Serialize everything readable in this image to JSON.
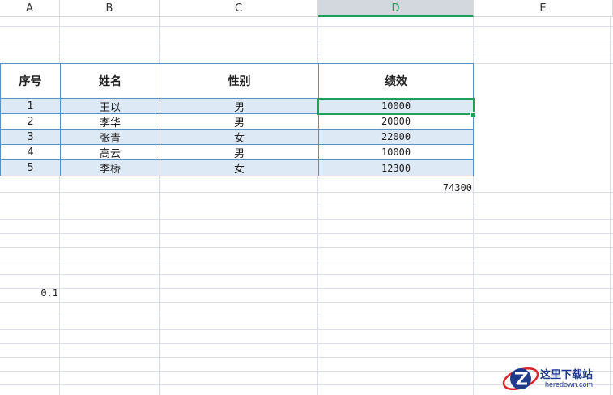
{
  "columns": [
    "A",
    "B",
    "C",
    "D",
    "E"
  ],
  "selected_column": "D",
  "table": {
    "headers": [
      "序号",
      "姓名",
      "性别",
      "绩效"
    ],
    "rows": [
      [
        "1",
        "王以",
        "男",
        "10000"
      ],
      [
        "2",
        "李华",
        "男",
        "20000"
      ],
      [
        "3",
        "张青",
        "女",
        "22000"
      ],
      [
        "4",
        "高云",
        "男",
        "10000"
      ],
      [
        "5",
        "李桥",
        "女",
        "12300"
      ]
    ]
  },
  "sum_value": "74300",
  "stray_value": "0.1",
  "watermark": {
    "name": "这里下载站",
    "url": "heredown.com"
  },
  "colors": {
    "accent": "#1fa05a",
    "table_border": "#5b8fbf",
    "stripe": "#dde9f5",
    "watermark": "#1f3a8a",
    "watermark_red": "#d9262c"
  }
}
